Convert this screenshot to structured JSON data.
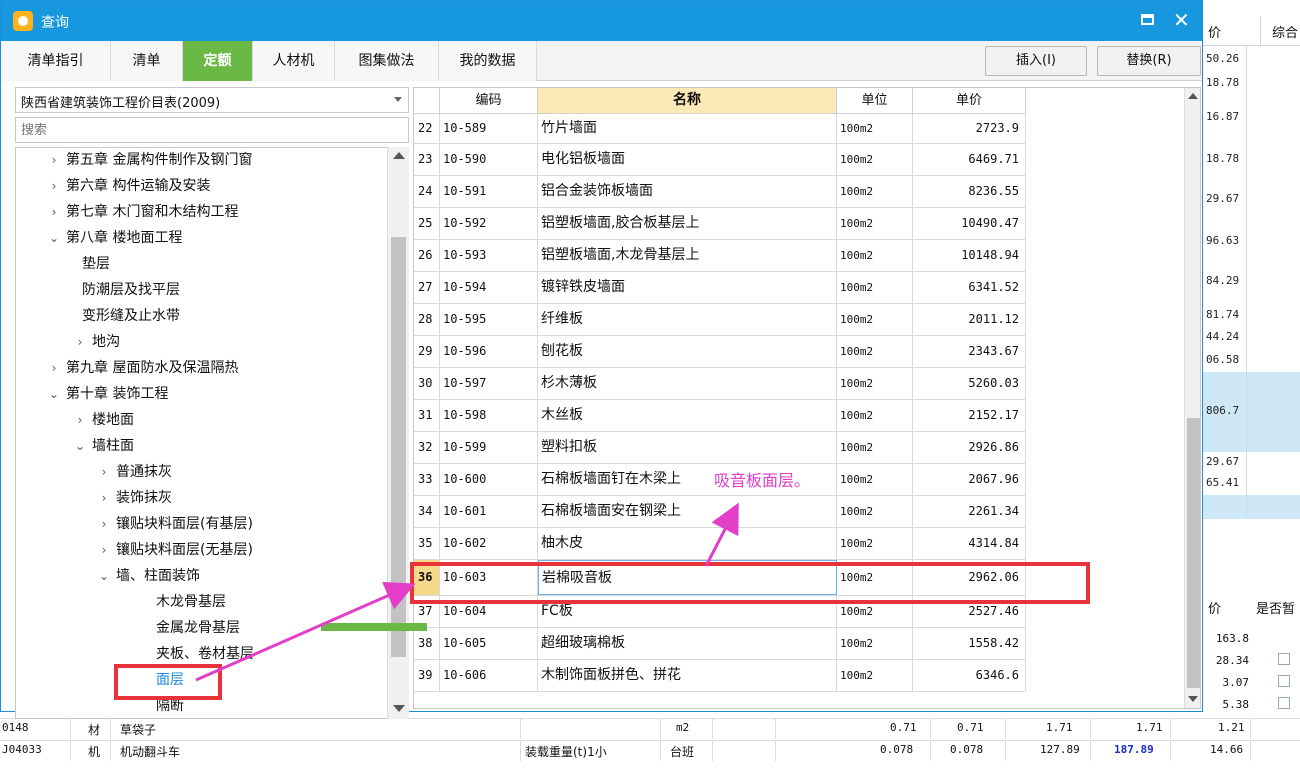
{
  "dialog": {
    "title": "查询",
    "tabs": [
      {
        "label": "清单指引",
        "active": false
      },
      {
        "label": "清单",
        "active": false
      },
      {
        "label": "定额",
        "active": true
      },
      {
        "label": "人材机",
        "active": false
      },
      {
        "label": "图集做法",
        "active": false
      },
      {
        "label": "我的数据",
        "active": false
      }
    ],
    "insert_button": "插入(I)",
    "replace_button": "替换(R)"
  },
  "left_panel": {
    "catalog_select": "陕西省建筑装饰工程价目表(2009)",
    "search_placeholder": "搜索",
    "tree": [
      {
        "label": "第五章 金属构件制作及钢门窗",
        "chevron": ">",
        "level": 0
      },
      {
        "label": "第六章 构件运输及安装",
        "chevron": ">",
        "level": 0
      },
      {
        "label": "第七章 木门窗和木结构工程",
        "chevron": ">",
        "level": 0
      },
      {
        "label": "第八章 楼地面工程",
        "chevron": "v",
        "level": 0
      },
      {
        "label": "垫层",
        "chevron": "",
        "level": 1
      },
      {
        "label": "防潮层及找平层",
        "chevron": "",
        "level": 1
      },
      {
        "label": "变形缝及止水带",
        "chevron": "",
        "level": 1
      },
      {
        "label": "地沟",
        "chevron": ">",
        "level": 1
      },
      {
        "label": "第九章 屋面防水及保温隔热",
        "chevron": ">",
        "level": 0
      },
      {
        "label": "第十章 装饰工程",
        "chevron": "v",
        "level": 0
      },
      {
        "label": "楼地面",
        "chevron": ">",
        "level": 1
      },
      {
        "label": "墙柱面",
        "chevron": "v",
        "level": 1
      },
      {
        "label": "普通抹灰",
        "chevron": ">",
        "level": 2
      },
      {
        "label": "装饰抹灰",
        "chevron": ">",
        "level": 2
      },
      {
        "label": "镶贴块料面层(有基层)",
        "chevron": ">",
        "level": 2
      },
      {
        "label": "镶贴块料面层(无基层)",
        "chevron": ">",
        "level": 2
      },
      {
        "label": "墙、柱面装饰",
        "chevron": "v",
        "level": 2
      },
      {
        "label": "木龙骨基层",
        "chevron": "",
        "level": 3
      },
      {
        "label": "金属龙骨基层",
        "chevron": "",
        "level": 3
      },
      {
        "label": "夹板、卷材基层",
        "chevron": "",
        "level": 3
      },
      {
        "label": "面层",
        "chevron": "",
        "level": 3,
        "selected": true
      },
      {
        "label": "隔断",
        "chevron": "",
        "level": 3
      }
    ]
  },
  "grid": {
    "headers": {
      "code": "编码",
      "name": "名称",
      "unit": "单位",
      "price": "单价"
    },
    "rows": [
      {
        "idx": "22",
        "code": "10-589",
        "name": "竹片墙面",
        "unit": "100m2",
        "price": "2723.9"
      },
      {
        "idx": "23",
        "code": "10-590",
        "name": "电化铝板墙面",
        "unit": "100m2",
        "price": "6469.71"
      },
      {
        "idx": "24",
        "code": "10-591",
        "name": "铝合金装饰板墙面",
        "unit": "100m2",
        "price": "8236.55"
      },
      {
        "idx": "25",
        "code": "10-592",
        "name": "铝塑板墙面,胶合板基层上",
        "unit": "100m2",
        "price": "10490.47"
      },
      {
        "idx": "26",
        "code": "10-593",
        "name": "铝塑板墙面,木龙骨基层上",
        "unit": "100m2",
        "price": "10148.94"
      },
      {
        "idx": "27",
        "code": "10-594",
        "name": "镀锌铁皮墙面",
        "unit": "100m2",
        "price": "6341.52"
      },
      {
        "idx": "28",
        "code": "10-595",
        "name": "纤维板",
        "unit": "100m2",
        "price": "2011.12"
      },
      {
        "idx": "29",
        "code": "10-596",
        "name": "刨花板",
        "unit": "100m2",
        "price": "2343.67"
      },
      {
        "idx": "30",
        "code": "10-597",
        "name": "杉木薄板",
        "unit": "100m2",
        "price": "5260.03"
      },
      {
        "idx": "31",
        "code": "10-598",
        "name": "木丝板",
        "unit": "100m2",
        "price": "2152.17"
      },
      {
        "idx": "32",
        "code": "10-599",
        "name": "塑料扣板",
        "unit": "100m2",
        "price": "2926.86"
      },
      {
        "idx": "33",
        "code": "10-600",
        "name": "石棉板墙面钉在木梁上",
        "unit": "100m2",
        "price": "2067.96"
      },
      {
        "idx": "34",
        "code": "10-601",
        "name": "石棉板墙面安在钢梁上",
        "unit": "100m2",
        "price": "2261.34"
      },
      {
        "idx": "35",
        "code": "10-602",
        "name": "柚木皮",
        "unit": "100m2",
        "price": "4314.84"
      },
      {
        "idx": "36",
        "code": "10-603",
        "name": "岩棉吸音板",
        "unit": "100m2",
        "price": "2962.06",
        "selected": true
      },
      {
        "idx": "37",
        "code": "10-604",
        "name": "FC板",
        "unit": "100m2",
        "price": "2527.46"
      },
      {
        "idx": "38",
        "code": "10-605",
        "name": "超细玻璃棉板",
        "unit": "100m2",
        "price": "1558.42"
      },
      {
        "idx": "39",
        "code": "10-606",
        "name": "木制饰面板拼色、拼花",
        "unit": "100m2",
        "price": "6346.6"
      }
    ]
  },
  "annotation": {
    "text": "吸音板面层。",
    "color": "#e23ec8",
    "box_color": "#e8333b"
  },
  "background": {
    "top_headers": [
      "价",
      "综合"
    ],
    "right_values": [
      "50.26",
      "18.78",
      "16.87",
      "18.78",
      "29.67",
      "96.63",
      "84.29",
      "81.74",
      "44.24",
      "06.58",
      "806.7",
      "29.67",
      "65.41"
    ],
    "lower_headers": [
      "价",
      "是否暂"
    ],
    "lower_values": [
      "163.8",
      "28.34",
      "3.07",
      "5.38",
      "1.21",
      "14.66"
    ],
    "rows": [
      {
        "code": "0148",
        "type": "材",
        "name": "草袋子",
        "spec": "",
        "unit": "m2",
        "v1": "0.71",
        "v2": "0.71",
        "v3": "1.71",
        "v4": "1.71",
        "v5": "1.21"
      },
      {
        "code": "J04033",
        "type": "机",
        "name": "机动翻斗车",
        "spec": "装载重量(t)1小",
        "unit": "台班",
        "v1": "0.078",
        "v2": "0.078",
        "v3": "127.89",
        "v4": "187.89",
        "v5": "14.66"
      }
    ]
  }
}
